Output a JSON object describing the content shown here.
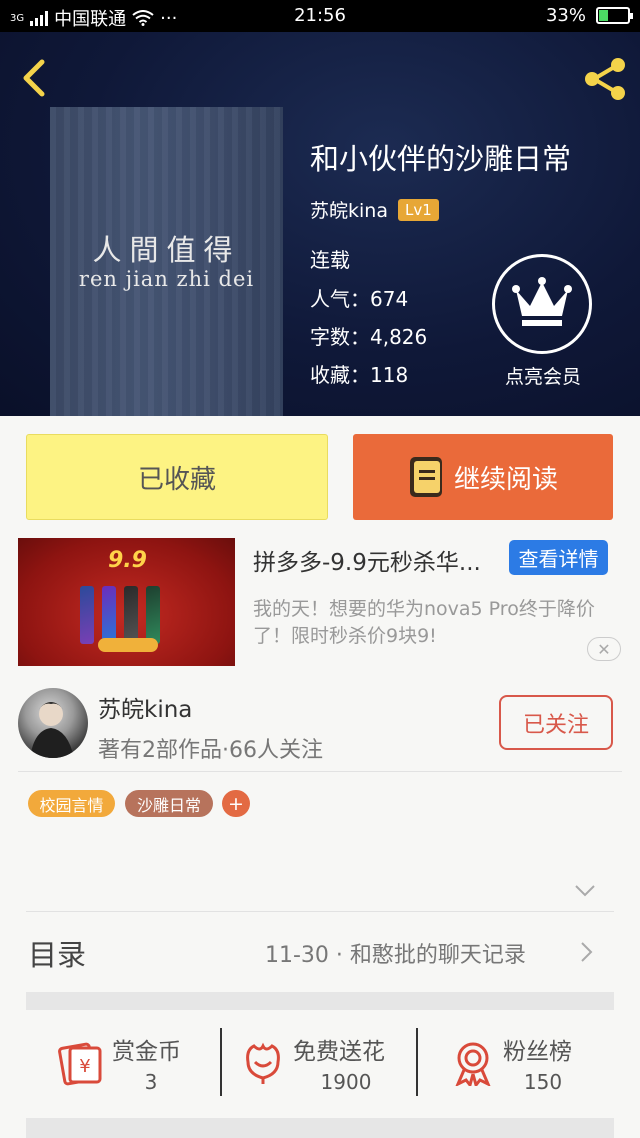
{
  "status_bar": {
    "network": "3G",
    "carrier": "中国联通",
    "more": "···",
    "time": "21:56",
    "battery": "33%",
    "battery_level": 0.33
  },
  "book": {
    "cover_title": "人間值得",
    "cover_pinyin": "ren jian zhi dei",
    "title": "和小伙伴的沙雕日常",
    "author": "苏皖kina",
    "level": "Lv1",
    "status": "连载",
    "popularity": "人气：674",
    "word_count": "字数：4,826",
    "favorites": "收藏：118",
    "vip_label": "点亮会员"
  },
  "actions": {
    "collected_label": "已收藏",
    "continue_label": "继续阅读"
  },
  "ad": {
    "price_badge": "9.9",
    "title": "拼多多-9.9元秒杀华...",
    "button": "查看详情",
    "description": "我的天！想要的华为nova5 Pro终于降价了！限时秒杀价9块9!"
  },
  "author": {
    "name": "苏皖kina",
    "meta": "著有2部作品·66人关注",
    "follow_label": "已关注"
  },
  "tags": [
    {
      "label": "校园言情",
      "color": "#f2a93b"
    },
    {
      "label": "沙雕日常",
      "color": "#b7735c"
    },
    {
      "label": "+",
      "color": "#e36a43"
    }
  ],
  "catalog": {
    "title": "目录",
    "latest": "11-30 · 和憨批的聊天记录"
  },
  "bottom_stats": [
    {
      "label": "赏金币",
      "value": "3",
      "icon": "reward-coin-icon"
    },
    {
      "label": "免费送花",
      "value": "1900",
      "icon": "flower-icon"
    },
    {
      "label": "粉丝榜",
      "value": "150",
      "icon": "medal-icon"
    }
  ],
  "colors": {
    "accent_orange": "#ea6a3a",
    "collected_yellow": "#fdf383",
    "icon_red": "#d94a3a",
    "level_badge": "#e7a736",
    "ad_button_blue": "#2c7be5"
  }
}
